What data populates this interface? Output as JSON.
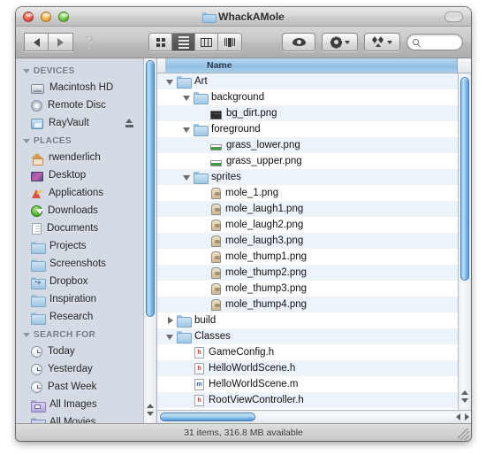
{
  "window": {
    "title": "WhackAMole",
    "title_icon": "folder-icon",
    "buttons": {
      "close": "close-button",
      "minimize": "minimize-button",
      "zoom": "zoom-button"
    },
    "toolbar_toggle": "toolbar-toggle-button"
  },
  "toolbar": {
    "back": "back-button",
    "forward": "forward-button",
    "help": "?",
    "view_modes": [
      {
        "name": "icon-view",
        "active": false
      },
      {
        "name": "list-view",
        "active": true
      },
      {
        "name": "column-view",
        "active": false
      },
      {
        "name": "coverflow-view",
        "active": false
      }
    ],
    "quicklook": "quick-look-button",
    "action": "action-menu-button",
    "dropbox": "dropbox-menu-button",
    "search_placeholder": ""
  },
  "sidebar": {
    "sections": [
      {
        "header": "DEVICES",
        "items": [
          {
            "label": "Macintosh HD",
            "icon": "hard-drive-icon",
            "eject": false
          },
          {
            "label": "Remote Disc",
            "icon": "disc-icon",
            "eject": false
          },
          {
            "label": "RayVault",
            "icon": "volume-icon",
            "eject": true
          }
        ]
      },
      {
        "header": "PLACES",
        "items": [
          {
            "label": "rwenderlich",
            "icon": "home-icon",
            "eject": false
          },
          {
            "label": "Desktop",
            "icon": "desktop-icon",
            "eject": false
          },
          {
            "label": "Applications",
            "icon": "applications-icon",
            "eject": false
          },
          {
            "label": "Downloads",
            "icon": "downloads-icon",
            "eject": false
          },
          {
            "label": "Documents",
            "icon": "documents-icon",
            "eject": false
          },
          {
            "label": "Projects",
            "icon": "folder-icon",
            "eject": false
          },
          {
            "label": "Screenshots",
            "icon": "folder-icon",
            "eject": false
          },
          {
            "label": "Dropbox",
            "icon": "dropbox-folder-icon",
            "eject": false
          },
          {
            "label": "Inspiration",
            "icon": "folder-icon",
            "eject": false
          },
          {
            "label": "Research",
            "icon": "folder-icon",
            "eject": false
          }
        ]
      },
      {
        "header": "SEARCH FOR",
        "items": [
          {
            "label": "Today",
            "icon": "clock-icon",
            "eject": false
          },
          {
            "label": "Yesterday",
            "icon": "clock-icon",
            "eject": false
          },
          {
            "label": "Past Week",
            "icon": "clock-icon",
            "eject": false
          },
          {
            "label": "All Images",
            "icon": "images-folder-icon",
            "eject": false
          },
          {
            "label": "All Movies",
            "icon": "movies-folder-icon",
            "eject": false
          }
        ]
      }
    ]
  },
  "filelist": {
    "column_header": "Name",
    "rows": [
      {
        "label": "Art",
        "indent": 0,
        "icon": "folder-icon",
        "twisty": "open"
      },
      {
        "label": "background",
        "indent": 1,
        "icon": "folder-icon",
        "twisty": "open"
      },
      {
        "label": "bg_dirt.png",
        "indent": 2,
        "icon": "png-dark-icon",
        "twisty": "none"
      },
      {
        "label": "foreground",
        "indent": 1,
        "icon": "folder-icon",
        "twisty": "open"
      },
      {
        "label": "grass_lower.png",
        "indent": 2,
        "icon": "png-grass-icon",
        "twisty": "none"
      },
      {
        "label": "grass_upper.png",
        "indent": 2,
        "icon": "png-grass-icon",
        "twisty": "none"
      },
      {
        "label": "sprites",
        "indent": 1,
        "icon": "folder-icon",
        "twisty": "open"
      },
      {
        "label": "mole_1.png",
        "indent": 2,
        "icon": "png-mole-icon",
        "twisty": "none"
      },
      {
        "label": "mole_laugh1.png",
        "indent": 2,
        "icon": "png-mole-icon",
        "twisty": "none"
      },
      {
        "label": "mole_laugh2.png",
        "indent": 2,
        "icon": "png-mole-icon",
        "twisty": "none"
      },
      {
        "label": "mole_laugh3.png",
        "indent": 2,
        "icon": "png-mole-icon",
        "twisty": "none"
      },
      {
        "label": "mole_thump1.png",
        "indent": 2,
        "icon": "png-mole-icon",
        "twisty": "none"
      },
      {
        "label": "mole_thump2.png",
        "indent": 2,
        "icon": "png-mole-icon",
        "twisty": "none"
      },
      {
        "label": "mole_thump3.png",
        "indent": 2,
        "icon": "png-mole-icon",
        "twisty": "none"
      },
      {
        "label": "mole_thump4.png",
        "indent": 2,
        "icon": "png-mole-icon",
        "twisty": "none"
      },
      {
        "label": "build",
        "indent": 0,
        "icon": "folder-icon",
        "twisty": "closed"
      },
      {
        "label": "Classes",
        "indent": 0,
        "icon": "folder-icon",
        "twisty": "open"
      },
      {
        "label": "GameConfig.h",
        "indent": 1,
        "icon": "header-file-icon",
        "twisty": "none"
      },
      {
        "label": "HelloWorldScene.h",
        "indent": 1,
        "icon": "header-file-icon",
        "twisty": "none"
      },
      {
        "label": "HelloWorldScene.m",
        "indent": 1,
        "icon": "source-file-icon",
        "twisty": "none"
      },
      {
        "label": "RootViewController.h",
        "indent": 1,
        "icon": "header-file-icon",
        "twisty": "none"
      }
    ]
  },
  "statusbar": {
    "text": "31 items, 316.8 MB available"
  },
  "colors": {
    "sidebar_bg": "#d4dbe4",
    "row_alt": "#edf3fb",
    "scroll_blue": "#4f92cf",
    "header_blue": "#9cc6e8"
  }
}
